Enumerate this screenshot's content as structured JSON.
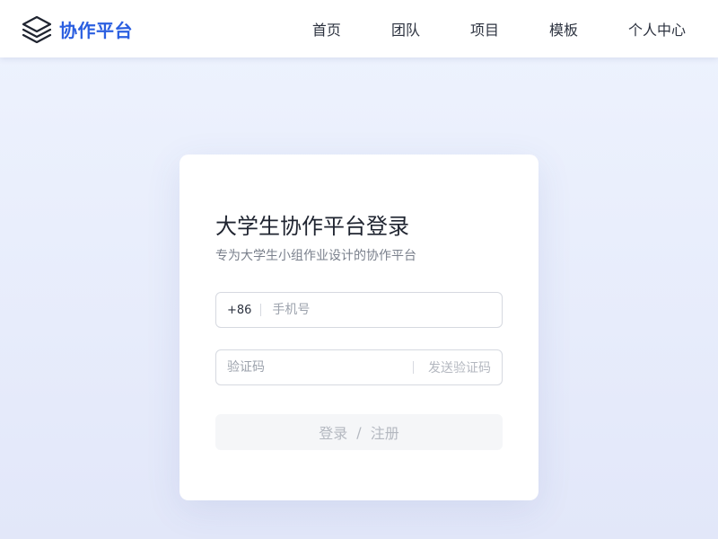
{
  "header": {
    "brand_icon": "layers-icon",
    "brand_name": "协作平台",
    "brand_color": "#2b5fe0",
    "nav": [
      {
        "label": "首页"
      },
      {
        "label": "团队"
      },
      {
        "label": "项目"
      },
      {
        "label": "模板"
      },
      {
        "label": "个人中心"
      }
    ]
  },
  "login": {
    "title": "大学生协作平台登录",
    "subtitle": "专为大学生小组作业设计的协作平台",
    "phone": {
      "prefix": "+86",
      "placeholder": "手机号",
      "value": ""
    },
    "code": {
      "placeholder": "验证码",
      "value": "",
      "send_label": "发送验证码"
    },
    "submit": {
      "login_label": "登录",
      "separator": "/",
      "register_label": "注册",
      "disabled": true
    }
  }
}
